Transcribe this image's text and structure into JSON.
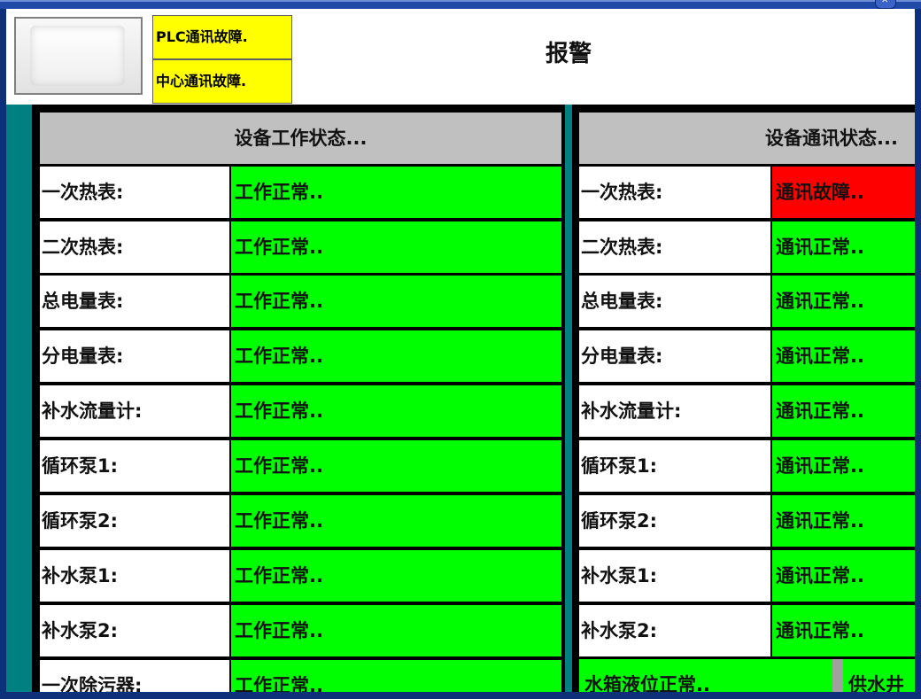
{
  "header": {
    "title": "报警",
    "alarms": [
      "PLC通讯故障.",
      "中心通讯故障."
    ]
  },
  "colors": {
    "ok": "#00ff00",
    "fault": "#ff0000",
    "panel_bg": "#008080",
    "alarm_bg": "#ffff00"
  },
  "work_status": {
    "title": "设备工作状态...",
    "rows": [
      {
        "label": "一次热表:",
        "status": "工作正常..",
        "state": "ok"
      },
      {
        "label": "二次热表:",
        "status": "工作正常..",
        "state": "ok"
      },
      {
        "label": "总电量表:",
        "status": "工作正常..",
        "state": "ok"
      },
      {
        "label": "分电量表:",
        "status": "工作正常..",
        "state": "ok"
      },
      {
        "label": "补水流量计:",
        "status": "工作正常..",
        "state": "ok"
      },
      {
        "label": "循环泵1:",
        "status": "工作正常..",
        "state": "ok"
      },
      {
        "label": "循环泵2:",
        "status": "工作正常..",
        "state": "ok"
      },
      {
        "label": "补水泵1:",
        "status": "工作正常..",
        "state": "ok"
      },
      {
        "label": "补水泵2:",
        "status": "工作正常..",
        "state": "ok"
      },
      {
        "label": "一次除污器:",
        "status": "工作正常..",
        "state": "ok"
      }
    ]
  },
  "comm_status": {
    "title": "设备通讯状态...",
    "rows": [
      {
        "label": "一次热表:",
        "status": "通讯故障..",
        "state": "fault"
      },
      {
        "label": "二次热表:",
        "status": "通讯正常..",
        "state": "ok"
      },
      {
        "label": "总电量表:",
        "status": "通讯正常..",
        "state": "ok"
      },
      {
        "label": "分电量表:",
        "status": "通讯正常..",
        "state": "ok"
      },
      {
        "label": "补水流量计:",
        "status": "通讯正常..",
        "state": "ok"
      },
      {
        "label": "循环泵1:",
        "status": "通讯正常..",
        "state": "ok"
      },
      {
        "label": "循环泵2:",
        "status": "通讯正常..",
        "state": "ok"
      },
      {
        "label": "补水泵1:",
        "status": "通讯正常..",
        "state": "ok"
      },
      {
        "label": "补水泵2:",
        "status": "通讯正常..",
        "state": "ok"
      }
    ],
    "bottom": [
      "水箱液位正常..",
      "供水井"
    ]
  }
}
